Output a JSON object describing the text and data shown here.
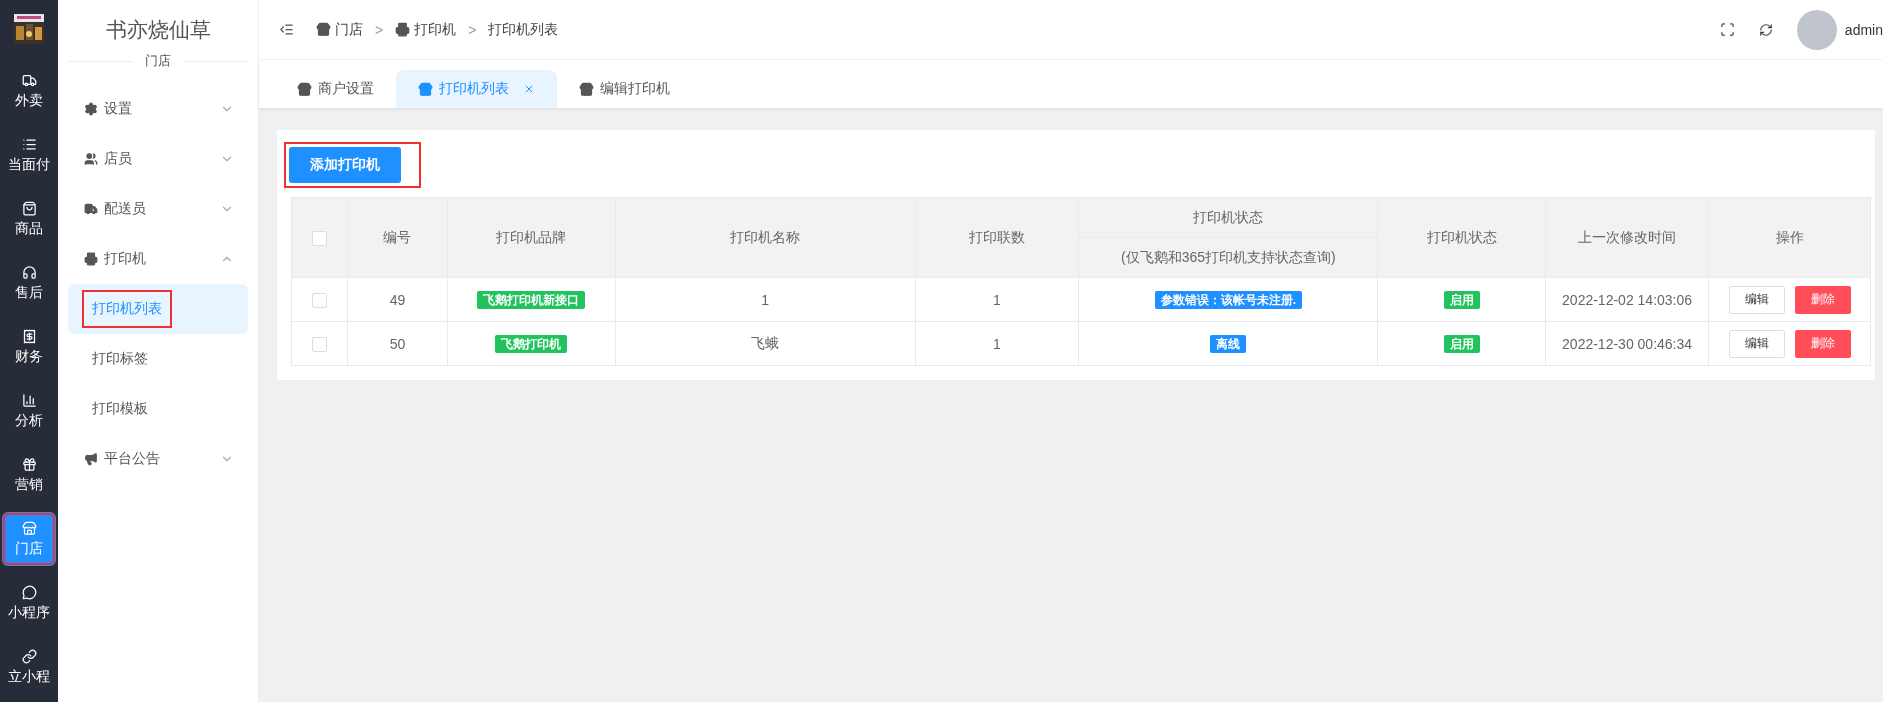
{
  "rail": {
    "items": [
      {
        "label": "外卖",
        "selected": false,
        "highlighted": false
      },
      {
        "label": "当面付",
        "selected": false,
        "highlighted": false
      },
      {
        "label": "商品",
        "selected": false,
        "highlighted": false
      },
      {
        "label": "售后",
        "selected": false,
        "highlighted": false
      },
      {
        "label": "财务",
        "selected": false,
        "highlighted": false
      },
      {
        "label": "分析",
        "selected": false,
        "highlighted": false
      },
      {
        "label": "营销",
        "selected": false,
        "highlighted": false
      },
      {
        "label": "门店",
        "selected": true,
        "highlighted": true
      },
      {
        "label": "小程序",
        "selected": false,
        "highlighted": false
      },
      {
        "label": "立小程",
        "selected": false,
        "highlighted": false
      }
    ]
  },
  "sidebar": {
    "title": "书亦烧仙草",
    "subtitle": "门店",
    "items": [
      {
        "label": "设置",
        "expanded": false
      },
      {
        "label": "店员",
        "expanded": false
      },
      {
        "label": "配送员",
        "expanded": false
      },
      {
        "label": "打印机",
        "expanded": true,
        "children": [
          {
            "label": "打印机列表",
            "selected": true,
            "highlighted": true
          },
          {
            "label": "打印标签",
            "selected": false,
            "highlighted": false
          },
          {
            "label": "打印模板",
            "selected": false,
            "highlighted": false
          }
        ]
      },
      {
        "label": "平台公告",
        "expanded": false
      }
    ]
  },
  "breadcrumb": [
    {
      "label": "门店"
    },
    {
      "label": "打印机"
    },
    {
      "label": "打印机列表"
    }
  ],
  "breadcrumb_separator": ">",
  "user": {
    "name": "admin"
  },
  "tabs": [
    {
      "label": "商户设置",
      "selected": false,
      "closable": false
    },
    {
      "label": "打印机列表",
      "selected": true,
      "closable": true
    },
    {
      "label": "编辑打印机",
      "selected": false,
      "closable": false
    }
  ],
  "add_button": {
    "label": "添加打印机",
    "highlighted": true
  },
  "table": {
    "columns": [
      "编号",
      "打印机品牌",
      "打印机名称",
      "打印联数",
      [
        "打印机状态",
        "(仅飞鹅和365打印机支持状态查询)"
      ],
      "打印机状态",
      "上一次修改时间",
      "操作"
    ],
    "all_checked": false,
    "rows": [
      {
        "checked": false,
        "id": "49",
        "brand": "飞鹅打印机新接口",
        "name": "1",
        "copies": "1",
        "status": {
          "text": "参数错误：该帐号未注册.",
          "color": "#1e90ff"
        },
        "enabled": {
          "text": "启用",
          "color": "#22c35e"
        },
        "time": "2022-12-02 14:03:06",
        "actions": [
          "编辑",
          "删除"
        ]
      },
      {
        "checked": false,
        "id": "50",
        "brand": "飞鹅打印机",
        "name": "飞蛾",
        "copies": "1",
        "status": {
          "text": "离线",
          "color": "#1e90ff"
        },
        "enabled": {
          "text": "启用",
          "color": "#22c35e"
        },
        "time": "2022-12-30 00:46:34",
        "actions": [
          "编辑",
          "删除"
        ]
      }
    ]
  }
}
